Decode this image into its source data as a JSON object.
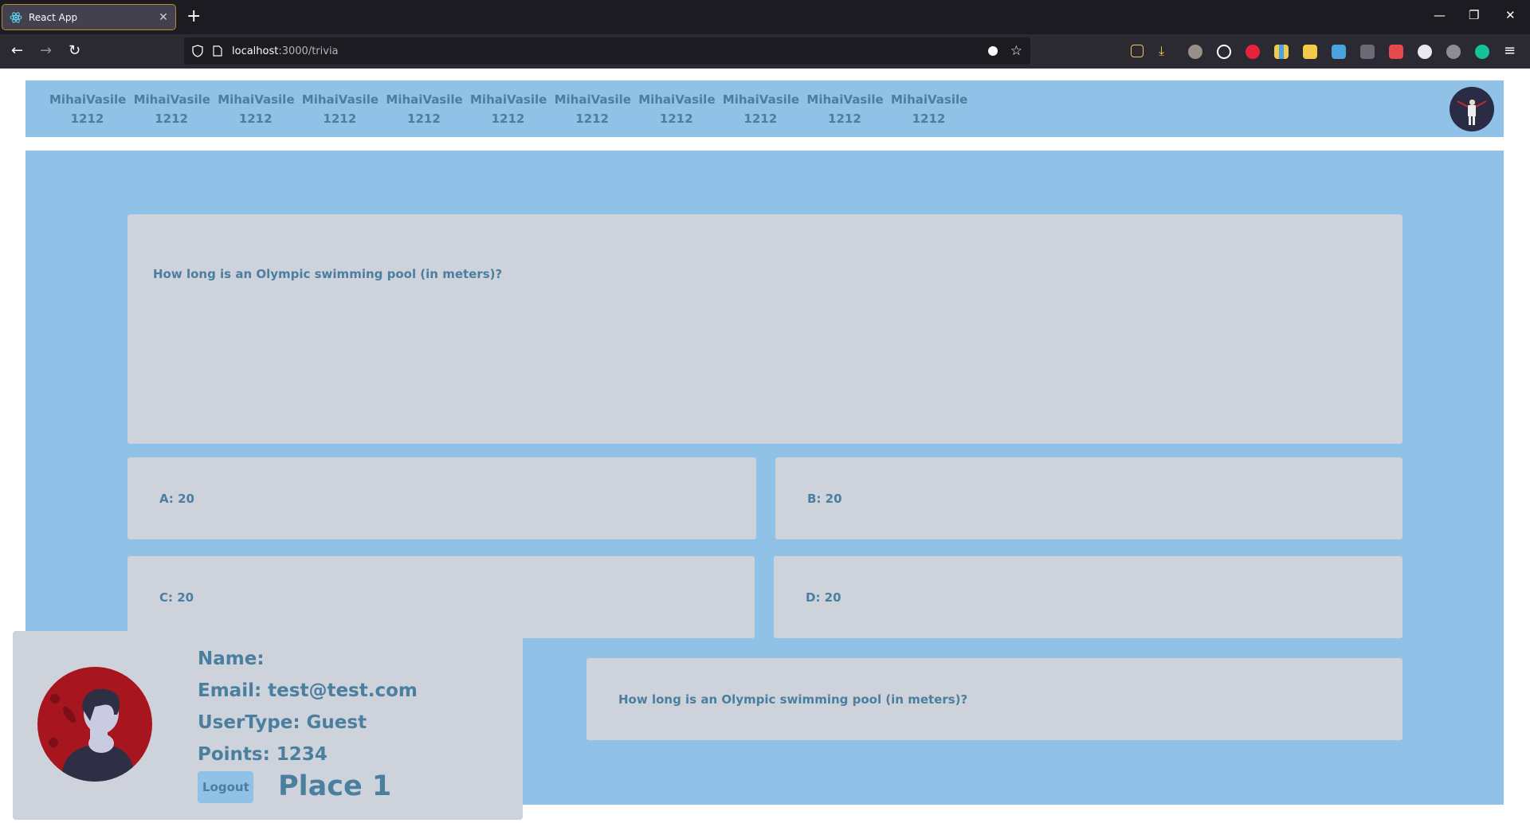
{
  "browser": {
    "tab_title": "React App",
    "url_host": "localhost",
    "url_path": ":3000/trivia"
  },
  "header": {
    "users": [
      {
        "name": "MihaiVasile",
        "score": "1212"
      },
      {
        "name": "MihaiVasile",
        "score": "1212"
      },
      {
        "name": "MihaiVasile",
        "score": "1212"
      },
      {
        "name": "MihaiVasile",
        "score": "1212"
      },
      {
        "name": "MihaiVasile",
        "score": "1212"
      },
      {
        "name": "MihaiVasile",
        "score": "1212"
      },
      {
        "name": "MihaiVasile",
        "score": "1212"
      },
      {
        "name": "MihaiVasile",
        "score": "1212"
      },
      {
        "name": "MihaiVasile",
        "score": "1212"
      },
      {
        "name": "MihaiVasile",
        "score": "1212"
      },
      {
        "name": "MihaiVasile",
        "score": "1212"
      }
    ]
  },
  "trivia": {
    "question": "How long is an Olympic swimming pool (in meters)?",
    "answers": {
      "a": "A: 20",
      "b": "B: 20",
      "c": "C: 20",
      "d": "D: 20"
    },
    "question_repeat": "How long is an Olympic swimming pool (in meters)?"
  },
  "profile": {
    "name_line": "Name:",
    "email_line": "Email: test@test.com",
    "usertype_line": "UserType: Guest",
    "points_line": "Points: 1234",
    "logout_label": "Logout",
    "place_line": "Place 1"
  },
  "colors": {
    "panel_blue": "#90c1e7",
    "card_gray": "#ced2db",
    "text_blue": "#4a7fa0",
    "avatar_red": "#a7161f"
  }
}
